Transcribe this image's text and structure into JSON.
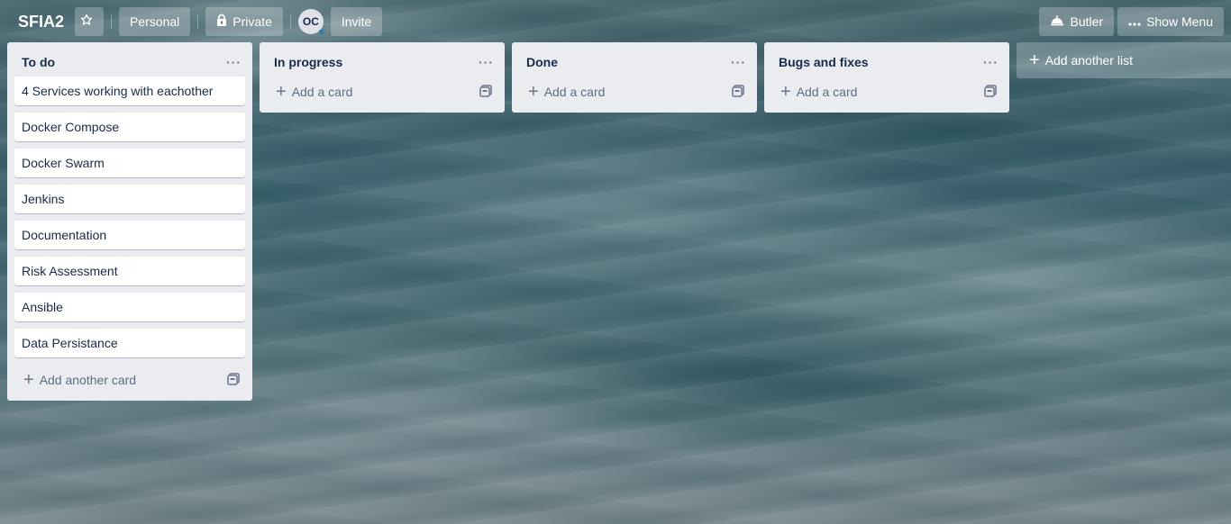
{
  "header": {
    "board_title": "SFIA2",
    "star_icon": "star-icon",
    "team_label": "Personal",
    "visibility_label": "Private",
    "member_initials": "OC",
    "invite_label": "Invite",
    "butler_label": "Butler",
    "show_menu_label": "Show Menu"
  },
  "lists": [
    {
      "title": "To do",
      "cards": [
        "4 Services working with eachother",
        "Docker Compose",
        "Docker Swarm",
        "Jenkins",
        "Documentation",
        "Risk Assessment",
        "Ansible",
        "Data Persistance"
      ],
      "composer_label": "Add another card"
    },
    {
      "title": "In progress",
      "cards": [],
      "composer_label": "Add a card"
    },
    {
      "title": "Done",
      "cards": [],
      "composer_label": "Add a card"
    },
    {
      "title": "Bugs and fixes",
      "cards": [],
      "composer_label": "Add a card"
    }
  ],
  "add_list_label": "Add another list",
  "colors": {
    "list_bg": "#ebecf0",
    "card_bg": "#ffffff",
    "text": "#172b4d",
    "muted": "#5e6c84"
  }
}
